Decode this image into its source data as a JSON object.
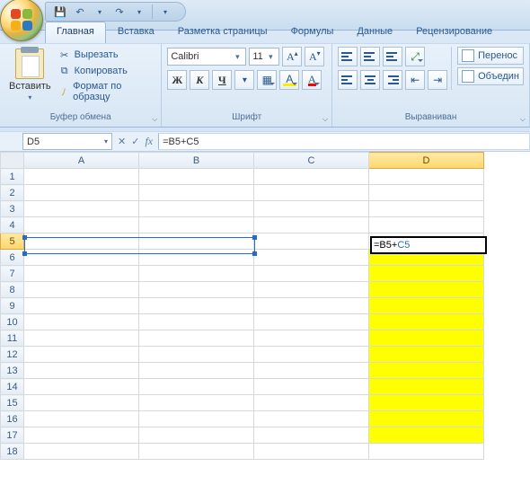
{
  "qat": {
    "save_tip": "save-icon",
    "undo_tip": "undo-icon",
    "redo_tip": "redo-icon"
  },
  "tabs": {
    "home": "Главная",
    "insert": "Вставка",
    "layout": "Разметка страницы",
    "formulas": "Формулы",
    "data": "Данные",
    "review": "Рецензирование"
  },
  "clipboard": {
    "paste": "Вставить",
    "cut": "Вырезать",
    "copy": "Копировать",
    "format_painter": "Формат по образцу",
    "group_label": "Буфер обмена"
  },
  "font": {
    "name": "Calibri",
    "size": "11",
    "group_label": "Шрифт",
    "grow": "A",
    "shrink": "A"
  },
  "align": {
    "group_label": "Выравниван",
    "wrap": "Перенос",
    "merge": "Объедин"
  },
  "formula_bar": {
    "cell_ref": "D5",
    "formula": "=B5+C5"
  },
  "grid": {
    "columns": [
      "A",
      "B",
      "C",
      "D"
    ],
    "rows": [
      1,
      2,
      3,
      4,
      5,
      6,
      7,
      8,
      9,
      10,
      11,
      12,
      13,
      14,
      15,
      16,
      17,
      18
    ],
    "selected_col": "D",
    "selected_row": 5,
    "active_cell_text": "=B5+C5",
    "yellow_range": {
      "col": "D",
      "from": 6,
      "to": 17
    }
  }
}
